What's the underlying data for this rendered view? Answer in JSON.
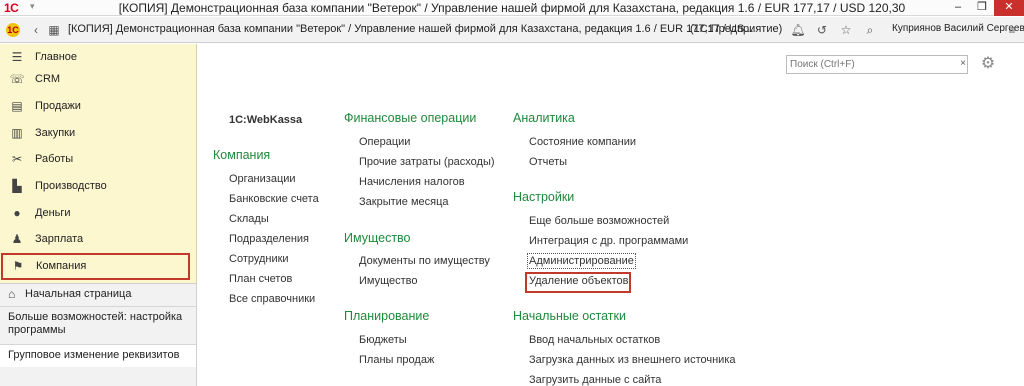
{
  "os_title": {
    "logo": "1С",
    "title": "[КОПИЯ] Демонстрационная база компании \"Ветерок\" / Управление нашей фирмой для Казахстана, редакция 1.6 / EUR 177,17 / USD 120,30"
  },
  "app_title": {
    "text": "[КОПИЯ] Демонстрационная база компании \"Ветерок\" / Управление нашей фирмой для Казахстана, редакция 1.6 / EUR 177,17 / US...",
    "mode": "(1С:Предприятие)",
    "user": "Куприянов Василий Сергеевич"
  },
  "sidebar": {
    "items": [
      {
        "label": "Главное",
        "icon": "menu-lines-icon"
      },
      {
        "label": "CRM",
        "icon": "crm-icon"
      },
      {
        "label": "Продажи",
        "icon": "cart-icon"
      },
      {
        "label": "Закупки",
        "icon": "purchase-icon"
      },
      {
        "label": "Работы",
        "icon": "tools-icon"
      },
      {
        "label": "Производство",
        "icon": "factory-icon"
      },
      {
        "label": "Деньги",
        "icon": "money-icon"
      },
      {
        "label": "Зарплата",
        "icon": "person-icon"
      },
      {
        "label": "Компания",
        "icon": "flag-icon",
        "active": true
      }
    ],
    "home_label": "Начальная страница",
    "open_items": [
      "Больше возможностей: настройка программы",
      "Групповое изменение реквизитов"
    ]
  },
  "search": {
    "placeholder": "Поиск (Ctrl+F)"
  },
  "columns": {
    "col1": {
      "top_link": "1С:WebKassa",
      "section": "Компания",
      "links": [
        "Организации",
        "Банковские счета",
        "Склады",
        "Подразделения",
        "Сотрудники",
        "План счетов",
        "Все справочники"
      ]
    },
    "col2": {
      "sections": [
        {
          "title": "Финансовые операции",
          "links": [
            "Операции",
            "Прочие затраты (расходы)",
            "Начисления налогов",
            "Закрытие месяца"
          ]
        },
        {
          "title": "Имущество",
          "links": [
            "Документы по имуществу",
            "Имущество"
          ]
        },
        {
          "title": "Планирование",
          "links": [
            "Бюджеты",
            "Планы продаж"
          ]
        }
      ]
    },
    "col3": {
      "sections": [
        {
          "title": "Аналитика",
          "links": [
            "Состояние компании",
            "Отчеты"
          ]
        },
        {
          "title": "Настройки",
          "links": [
            "Еще больше возможностей",
            "Интеграция с др. программами",
            "Администрирование",
            "Удаление объектов"
          ]
        },
        {
          "title": "Начальные остатки",
          "links": [
            "Ввод начальных остатков",
            "Загрузка данных из внешнего источника",
            "Загрузить данные с сайта"
          ]
        }
      ]
    }
  },
  "colors": {
    "sidebar_bg": "#fcf7cf",
    "section_title": "#1e8a3a",
    "highlight_border": "#c0392b"
  }
}
